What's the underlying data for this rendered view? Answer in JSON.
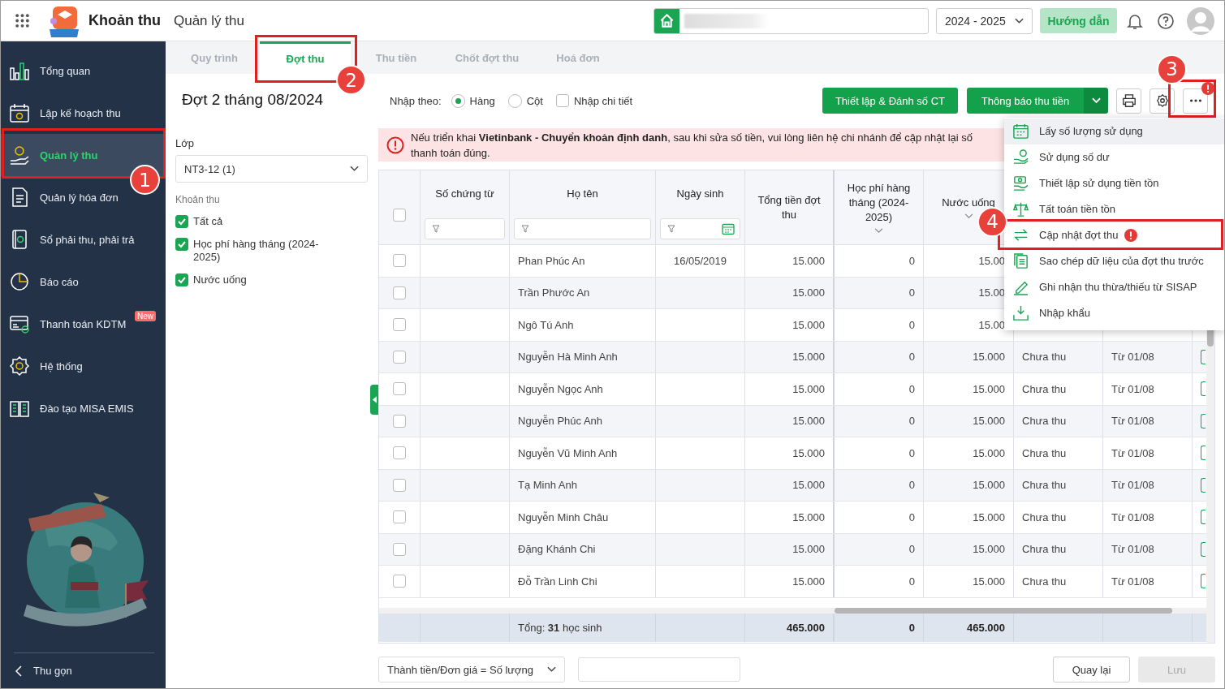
{
  "app": {
    "title": "Khoản thu",
    "section": "Quản lý thu"
  },
  "header": {
    "year": "2024 - 2025",
    "guide_button": "Hướng dẫn"
  },
  "sidebar": {
    "items": [
      {
        "label": "Tổng quan",
        "selected": false
      },
      {
        "label": "Lập kế hoạch thu",
        "selected": false
      },
      {
        "label": "Quản lý thu",
        "selected": true,
        "step": "1"
      },
      {
        "label": "Quản lý hóa đơn",
        "selected": false
      },
      {
        "label": "Sổ phải thu, phải trả",
        "selected": false
      },
      {
        "label": "Báo cáo",
        "selected": false
      },
      {
        "label": "Thanh toán KDTM",
        "selected": false,
        "badge": "New"
      },
      {
        "label": "Hệ thống",
        "selected": false
      },
      {
        "label": "Đào tạo MISA EMIS",
        "selected": false
      }
    ],
    "collapse": "Thu gọn"
  },
  "tabs": [
    {
      "label": "Quy trình",
      "selected": false
    },
    {
      "label": "Đợt thu",
      "selected": true,
      "step": "2"
    },
    {
      "label": "Thu tiền",
      "selected": false
    },
    {
      "label": "Chốt đợt thu",
      "selected": false
    },
    {
      "label": "Hoá đơn",
      "selected": false
    }
  ],
  "batch": {
    "title": "Đợt 2 tháng 08/2024",
    "class_label": "Lớp",
    "class_value": "NT3-12 (1)",
    "fees_label": "Khoản thu",
    "fees": [
      {
        "label": "Tất cả",
        "checked": true
      },
      {
        "label": "Học phí hàng tháng (2024-2025)",
        "checked": true
      },
      {
        "label": "Nước uống",
        "checked": true
      }
    ]
  },
  "toolbar": {
    "mode_label": "Nhập theo:",
    "modes": [
      {
        "label": "Hàng",
        "selected": true
      },
      {
        "label": "Cột",
        "selected": false
      }
    ],
    "detail": {
      "label": "Nhập chi tiết",
      "checked": false
    },
    "setup_button": "Thiết lập & Đánh số CT",
    "notify_button": "Thông báo thu tiền",
    "more": {
      "step": "3",
      "alert": true
    }
  },
  "alert": "Nếu triển khai **Vietinbank - Chuyển khoản định danh**, sau khi sửa số tiền, vui lòng liên hệ chi nhánh để cập nhật lại số thanh toán đúng.",
  "menu": {
    "items": [
      {
        "label": "Lấy số lượng sử dụng",
        "hovered": true,
        "alert": false
      },
      {
        "label": "Sử dụng số dư",
        "hovered": false,
        "alert": false
      },
      {
        "label": "Thiết lập sử dụng tiền tồn",
        "hovered": false,
        "alert": false
      },
      {
        "label": "Tất toán tiền tồn",
        "hovered": false,
        "alert": false
      },
      {
        "label": "Cập nhật đợt thu",
        "hovered": false,
        "alert": true,
        "step": "4"
      },
      {
        "label": "Sao chép dữ liệu của đợt thu trước",
        "hovered": false,
        "alert": false
      },
      {
        "label": "Ghi nhận thu thừa/thiếu từ SISAP",
        "hovered": false,
        "alert": false
      },
      {
        "label": "Nhập khẩu",
        "hovered": false,
        "alert": false
      }
    ]
  },
  "table": {
    "header_checked": false,
    "columns": [
      {
        "label": "Số chứng từ",
        "kind": "text-filter"
      },
      {
        "label": "Họ tên",
        "kind": "text-filter"
      },
      {
        "label": "Ngày sinh",
        "kind": "date-filter"
      },
      {
        "label": "Tổng tiền đợt thu",
        "kind": "plain"
      },
      {
        "label": "Học phí hàng tháng (2024-2025)",
        "kind": "dropdown"
      },
      {
        "label": "Nước uống",
        "kind": "dropdown"
      }
    ],
    "rows": [
      {
        "checked": false,
        "name": "Phan Phúc An",
        "dob": "16/05/2019",
        "total": "15.000",
        "tuition": "0",
        "water": "15.00"
      },
      {
        "checked": false,
        "name": "Trần Phước An",
        "total": "15.000",
        "tuition": "0",
        "water": "15.00"
      },
      {
        "checked": false,
        "name": "Ngô Tú Anh",
        "total": "15.000",
        "tuition": "0",
        "water": "15.00"
      },
      {
        "checked": false,
        "name": "Nguyễn Hà Minh Anh",
        "total": "15.000",
        "tuition": "0",
        "water": "15.000",
        "status": "Chưa thu",
        "period": "Từ 01/08"
      },
      {
        "checked": false,
        "name": "Nguyễn Ngọc Anh",
        "total": "15.000",
        "tuition": "0",
        "water": "15.000",
        "status": "Chưa thu",
        "period": "Từ 01/08"
      },
      {
        "checked": false,
        "name": "Nguyễn Phúc Anh",
        "total": "15.000",
        "tuition": "0",
        "water": "15.000",
        "status": "Chưa thu",
        "period": "Từ 01/08"
      },
      {
        "checked": false,
        "name": "Nguyễn Vũ Minh Anh",
        "total": "15.000",
        "tuition": "0",
        "water": "15.000",
        "status": "Chưa thu",
        "period": "Từ 01/08"
      },
      {
        "checked": false,
        "name": "Tạ Minh Anh",
        "total": "15.000",
        "tuition": "0",
        "water": "15.000",
        "status": "Chưa thu",
        "period": "Từ 01/08"
      },
      {
        "checked": false,
        "name": "Nguyễn Minh Châu",
        "total": "15.000",
        "tuition": "0",
        "water": "15.000",
        "status": "Chưa thu",
        "period": "Từ 01/08"
      },
      {
        "checked": false,
        "name": "Đặng Khánh Chi",
        "total": "15.000",
        "tuition": "0",
        "water": "15.000",
        "status": "Chưa thu",
        "period": "Từ 01/08"
      },
      {
        "checked": false,
        "name": "Đỗ Trần Linh Chi",
        "total": "15.000",
        "tuition": "0",
        "water": "15.000",
        "status": "Chưa thu",
        "period": "Từ 01/08"
      }
    ],
    "footer": {
      "summary": "Tổng: **31** học sinh",
      "total": "465.000",
      "tuition": "0",
      "water": "465.000"
    }
  },
  "bottom": {
    "formula": "Thành tiền/Đơn giá = Số lượng",
    "back_button": "Quay lại",
    "save_button": {
      "label": "Lưu",
      "disabled": true
    }
  }
}
